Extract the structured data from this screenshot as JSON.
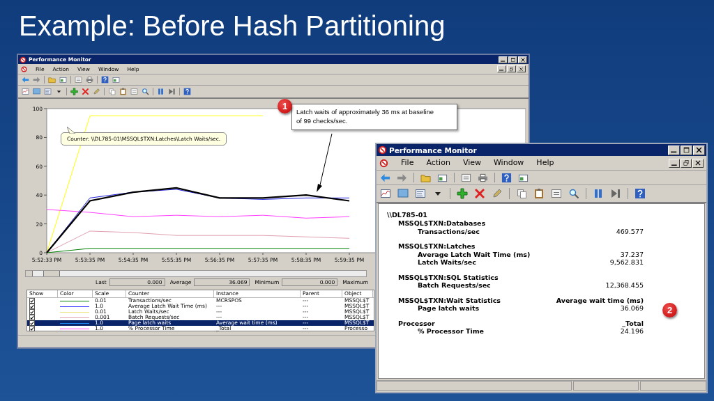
{
  "slide_title": "Example: Before Hash Partitioning",
  "window_main": {
    "title": "Performance Monitor",
    "menu": [
      "File",
      "Action",
      "View",
      "Window",
      "Help"
    ],
    "chart_data": {
      "type": "line",
      "categories": [
        "5:52:33 PM",
        "5:53:35 PM",
        "5:54:35 PM",
        "5:55:35 PM",
        "5:56:35 PM",
        "5:57:35 PM",
        "5:58:35 PM",
        "5:59:35 PM"
      ],
      "ylim": [
        0,
        100
      ],
      "yticks": [
        0,
        20,
        40,
        60,
        80,
        100
      ],
      "series": [
        {
          "color": "#ffff00",
          "values": [
            0,
            95,
            95,
            95,
            95,
            95,
            null,
            null
          ]
        },
        {
          "color": "#e0a0b0",
          "values": [
            0,
            15,
            14,
            12,
            12,
            12,
            11,
            10
          ]
        },
        {
          "color": "#ff40ff",
          "values": [
            30,
            28,
            25,
            26,
            25,
            26,
            24,
            25
          ]
        },
        {
          "color": "#008000",
          "values": [
            0,
            3,
            3,
            3,
            3,
            3,
            3,
            3
          ]
        },
        {
          "color": "#2020e0",
          "values": [
            0,
            38,
            42,
            44,
            38,
            37,
            38,
            38
          ]
        },
        {
          "color": "#000000",
          "values": [
            0,
            36,
            42,
            45,
            38,
            38,
            40,
            36
          ]
        }
      ]
    },
    "tooltip": "Counter: \\\\DL785-01\\MSSQL$TXN:Latches\\Latch Waits/sec.",
    "stats": [
      {
        "label": "Last",
        "value": "0.000"
      },
      {
        "label": "Average",
        "value": "36.069"
      },
      {
        "label": "Minimum",
        "value": "0.000"
      },
      {
        "label": "Maximum"
      }
    ],
    "table": {
      "columns": [
        "Show",
        "Color",
        "Scale",
        "Counter",
        "Instance",
        "Parent",
        "Object"
      ],
      "rows": [
        {
          "checked": true,
          "color": "#008000",
          "scale": "0.01",
          "counter": "Transactions/sec",
          "instance": "MCRSPOS",
          "parent": "---",
          "object": "MSSQL$T",
          "selected": false
        },
        {
          "checked": true,
          "color": "#4040ff",
          "scale": "1.0",
          "counter": "Average Latch Wait Time (ms)",
          "instance": "---",
          "parent": "---",
          "object": "MSSQL$T",
          "selected": false
        },
        {
          "checked": true,
          "color": "#e8e070",
          "scale": "0.01",
          "counter": "Latch Waits/sec",
          "instance": "---",
          "parent": "---",
          "object": "MSSQL$T",
          "selected": false
        },
        {
          "checked": true,
          "color": "#e0a0b0",
          "scale": "0.001",
          "counter": "Batch Requests/sec",
          "instance": "---",
          "parent": "---",
          "object": "MSSQL$T",
          "selected": false
        },
        {
          "checked": true,
          "color": "#1e90ff",
          "scale": "1.0",
          "counter": "Page latch waits",
          "instance": "Average wait time (ms)",
          "parent": "---",
          "object": "MSSQL$T",
          "selected": true
        },
        {
          "checked": true,
          "color": "#ff40ff",
          "scale": "1.0",
          "counter": "% Processor Time",
          "instance": "_Total",
          "parent": "---",
          "object": "Processo",
          "selected": false
        }
      ]
    }
  },
  "window_report": {
    "title": "Performance Monitor",
    "menu": [
      "File",
      "Action",
      "View",
      "Window",
      "Help"
    ],
    "report": {
      "host": "\\\\DL785-01",
      "objects": [
        {
          "name": "MSSQL$TXN:Databases",
          "counters": [
            {
              "name": "Transactions/sec",
              "value": "469.577"
            }
          ]
        },
        {
          "name": "MSSQL$TXN:Latches",
          "counters": [
            {
              "name": "Average Latch Wait Time (ms)",
              "value": "37.237"
            },
            {
              "name": "Latch Waits/sec",
              "value": "9,562.831"
            }
          ]
        },
        {
          "name": "MSSQL$TXN:SQL Statistics",
          "counters": [
            {
              "name": "Batch Requests/sec",
              "value": "12,368.455"
            }
          ]
        },
        {
          "name": "MSSQL$TXN:Wait Statistics",
          "instance": "Average wait time (ms)",
          "counters": [
            {
              "name": "Page latch waits",
              "value": "36.069"
            }
          ]
        },
        {
          "name": "Processor",
          "instance": "_Total",
          "counters": [
            {
              "name": "% Processor Time",
              "value": "24.196"
            }
          ]
        }
      ]
    }
  },
  "annotations": [
    {
      "kind": "callout",
      "number": "1",
      "text": "Latch waits of approximately 36 ms at baseline of 99 checks/sec."
    },
    {
      "kind": "badge",
      "number": "2"
    }
  ]
}
